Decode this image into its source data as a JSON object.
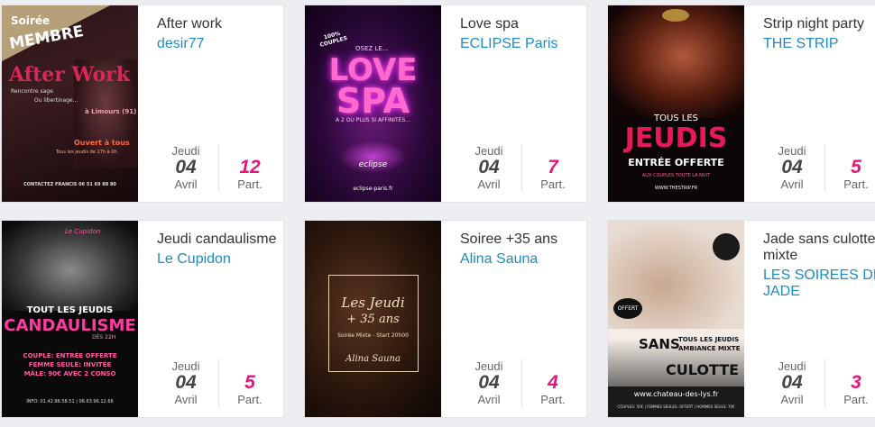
{
  "events": [
    {
      "title": "After work",
      "club": "desir77",
      "dow": "Jeudi",
      "day": "04",
      "month": "Avril",
      "participants": "12",
      "part_label": "Part.",
      "poster": {
        "ribbon_top": "Soirée",
        "ribbon_main": "MEMBRE",
        "headline": "After Work",
        "tag1": "Rencontre sage",
        "tag2": "Ou libertinage...",
        "location": "à Limours (91)",
        "open": "Ouvert à tous",
        "schedule": "Tous les jeudis de 17h à 0h",
        "contact": "CONTACTEZ FRANCIS 06 51 69 88 80"
      }
    },
    {
      "title": "Love spa",
      "club": "ECLIPSE Paris",
      "dow": "Jeudi",
      "day": "04",
      "month": "Avril",
      "participants": "7",
      "part_label": "Part.",
      "poster": {
        "badge": "100% COUPLES",
        "osez": "OSEZ LE...",
        "love": "LOVE",
        "spa": "SPA",
        "sub": "A 2 OU PLUS SI AFFINITÉS...",
        "brand": "eclipse",
        "site": "eclipse-paris.fr"
      }
    },
    {
      "title": "Strip night party",
      "club": "THE STRIP",
      "dow": "Jeudi",
      "day": "04",
      "month": "Avril",
      "participants": "5",
      "part_label": "Part.",
      "poster": {
        "tous": "TOUS LES",
        "jeudis": "JEUDIS",
        "entree": "ENTRÉE OFFERTE",
        "fine": "AUX COUPLES TOUTE LA NUIT",
        "site": "WWW.THESTRIP.FR"
      }
    },
    {
      "title": "Jeudi candaulisme",
      "club": "Le Cupidon",
      "dow": "Jeudi",
      "day": "04",
      "month": "Avril",
      "participants": "5",
      "part_label": "Part.",
      "poster": {
        "brand": "Le Cupidon",
        "tous": "TOUT LES JEUDIS",
        "main": "CANDAULISME",
        "time": "DÈS 22H",
        "l1": "COUPLE: ENTRÉE OFFERTE",
        "l2": "FEMME SEULE: INVITÉE",
        "l3": "MÂLE: 90€ AVEC 2 CONSO",
        "info": "INFO: 01.42.96.58.51 | 06.63.96.12.66"
      }
    },
    {
      "title": "Soiree +35 ans",
      "club": "Alina Sauna",
      "dow": "Jeudi",
      "day": "04",
      "month": "Avril",
      "participants": "4",
      "part_label": "Part.",
      "poster": {
        "l1": "Les Jeudi",
        "l2": "+ 35 ans",
        "l3": "Soirée Mixte - Start 20h00",
        "l4": "Alina Sauna"
      }
    },
    {
      "title": "Jade sans culotte mixte",
      "club": "LES SOIREES DE JADE",
      "dow": "Jeudi",
      "day": "04",
      "month": "Avril",
      "participants": "3",
      "part_label": "Part.",
      "poster": {
        "sans": "SANS",
        "tous": "TOUS LES JEUDIS",
        "ambiance": "AMBIANCE MIXTE",
        "culotte": "CULOTTE",
        "site": "www.chateau-des-lys.fr",
        "badge": "OFFERT",
        "foot": "COUPLES: 50€ | FEMMES SEULES: OFFERT | HOMMES SEULS: 70€"
      }
    }
  ]
}
